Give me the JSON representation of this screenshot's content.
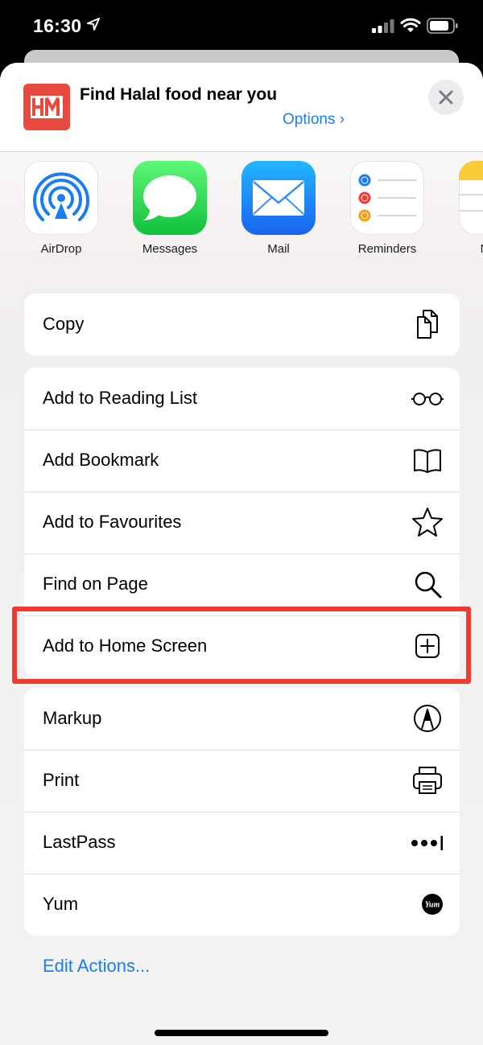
{
  "status_bar": {
    "time": "16:30"
  },
  "header": {
    "app_logo_text": "HM",
    "title": "Find Halal food near you",
    "options_label": "Options ›"
  },
  "apps": [
    {
      "label": "AirDrop",
      "icon": "airdrop-icon"
    },
    {
      "label": "Messages",
      "icon": "messages-icon"
    },
    {
      "label": "Mail",
      "icon": "mail-icon"
    },
    {
      "label": "Reminders",
      "icon": "reminders-icon"
    },
    {
      "label": "N",
      "icon": "notes-icon"
    }
  ],
  "groups": {
    "copy": [
      {
        "label": "Copy",
        "icon": "copy-icon"
      }
    ],
    "safari": [
      {
        "label": "Add to Reading List",
        "icon": "glasses-icon"
      },
      {
        "label": "Add Bookmark",
        "icon": "book-icon"
      },
      {
        "label": "Add to Favourites",
        "icon": "star-icon"
      },
      {
        "label": "Find on Page",
        "icon": "magnifier-icon"
      },
      {
        "label": "Add to Home Screen",
        "icon": "plus-square-icon"
      }
    ],
    "extensions": [
      {
        "label": "Markup",
        "icon": "markup-icon"
      },
      {
        "label": "Print",
        "icon": "printer-icon"
      },
      {
        "label": "LastPass",
        "icon": "lastpass-icon"
      },
      {
        "label": "Yum",
        "icon": "yum-icon"
      }
    ]
  },
  "yum_logo_text": "Yum",
  "edit_actions_label": "Edit Actions...",
  "colors": {
    "accent": "#1a7ef0",
    "highlight": "#f23b30",
    "logo": "#e84a3d"
  }
}
